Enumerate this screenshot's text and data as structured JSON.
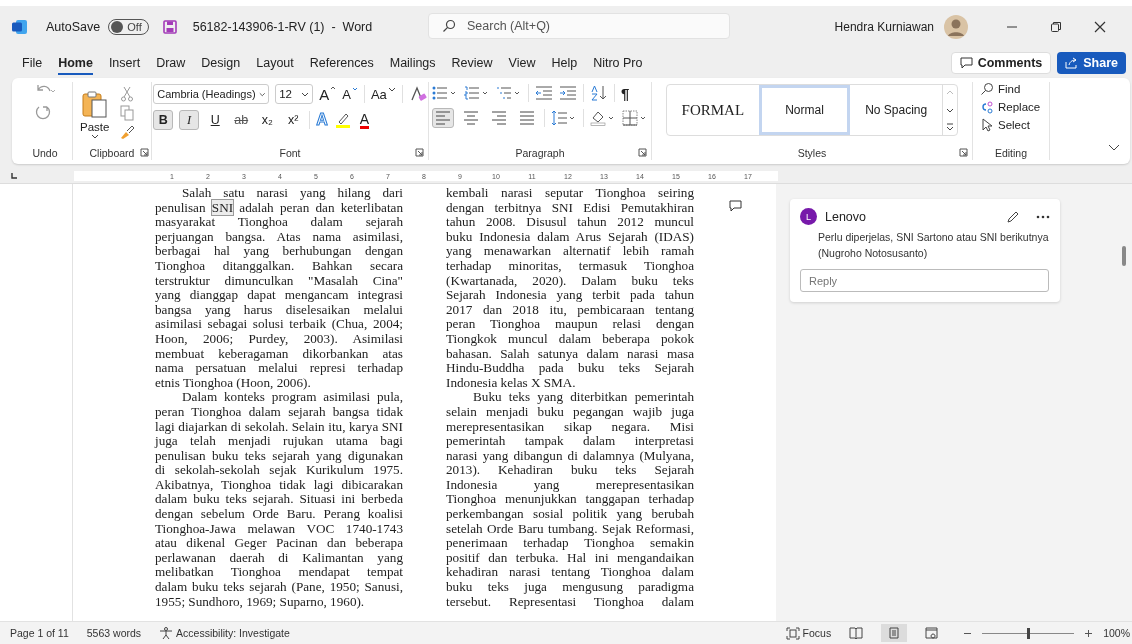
{
  "title_bar": {
    "autosave_label": "AutoSave",
    "autosave": {
      "on": false,
      "label": "Off"
    },
    "document_title": "56182-143906-1-RV (1)  -  Word",
    "search": {
      "placeholder": "Search (Alt+Q)"
    },
    "user_name": "Hendra Kurniawan"
  },
  "menu_tabs": [
    {
      "label": "File",
      "selected": false
    },
    {
      "label": "Home",
      "selected": true
    },
    {
      "label": "Insert",
      "selected": false
    },
    {
      "label": "Draw",
      "selected": false
    },
    {
      "label": "Design",
      "selected": false
    },
    {
      "label": "Layout",
      "selected": false
    },
    {
      "label": "References",
      "selected": false
    },
    {
      "label": "Mailings",
      "selected": false
    },
    {
      "label": "Review",
      "selected": false
    },
    {
      "label": "View",
      "selected": false
    },
    {
      "label": "Help",
      "selected": false
    },
    {
      "label": "Nitro Pro",
      "selected": false
    }
  ],
  "comments_button": "Comments",
  "share_button": "Share",
  "undo_group": {
    "label": "Undo"
  },
  "clipboard_group": {
    "label": "Clipboard",
    "paste": "Paste"
  },
  "font_group": {
    "label": "Font",
    "font_name": "Cambria (Headings)",
    "font_size": "12",
    "grow": "A",
    "shrink": "A",
    "change_case": "Aa",
    "format_buttons": [
      {
        "label": "B",
        "kind": "bold",
        "selected": true
      },
      {
        "label": "I",
        "kind": "italic",
        "selected": true
      },
      {
        "label": "U",
        "kind": "underline",
        "selected": false
      },
      {
        "label": "ab",
        "kind": "strike",
        "selected": false
      },
      {
        "label": "x₂",
        "kind": "subscript",
        "selected": false
      },
      {
        "label": "x²",
        "kind": "superscript",
        "selected": false
      }
    ],
    "text_effects": "A",
    "font_color": "A"
  },
  "paragraph_group": {
    "label": "Paragraph",
    "pilcrow": "¶",
    "alignments": [
      {
        "kind": "left",
        "selected": true
      },
      {
        "kind": "center",
        "selected": false
      },
      {
        "kind": "right",
        "selected": false
      },
      {
        "kind": "justify",
        "selected": false
      }
    ]
  },
  "styles_group": {
    "label": "Styles",
    "styles": [
      {
        "label": "FORMAL",
        "kind": "serif",
        "selected": false
      },
      {
        "label": "Normal",
        "kind": "sans",
        "selected": true
      },
      {
        "label": "No Spacing",
        "kind": "sans",
        "selected": false
      }
    ]
  },
  "editing_group": {
    "label": "Editing",
    "items": [
      {
        "label": "Find",
        "kind": "find"
      },
      {
        "label": "Replace",
        "kind": "replace"
      },
      {
        "label": "Select",
        "kind": "select"
      }
    ]
  },
  "ruler_marks": [
    "1",
    "2",
    "3",
    "4",
    "5",
    "6",
    "7",
    "8",
    "9",
    "10",
    "11",
    "12",
    "13",
    "14",
    "15",
    "16",
    "17"
  ],
  "columns": [
    {
      "paragraphs": [
        {
          "first_line_indent": true,
          "continues": false,
          "lines": [
            "Salah satu narasi yang hilang dari",
            {
              "before": "penulisan ",
              "anchor": "SNI",
              "after": " adalah peran dan keterlibatan"
            },
            "masyarakat Tionghoa dalam sejarah",
            "perjuangan bangsa. Atas nama asimilasi,",
            "berbagai hal yang berhubungan dengan",
            "Tionghoa ditanggalkan. Bahkan secara",
            "terstruktur dimunculkan \"Masalah Cina\"",
            "yang dianggap dapat mengancam integrasi",
            "bangsa yang harus diselesaikan melalui",
            "asimilasi sebagai solusi terbaik (Chua, 2004;",
            "Hoon, 2006; Purdey, 2003). Asimilasi",
            "membuat keberagaman dikorbankan atas",
            "nama persatuan melalui represi terhadap",
            "etnis Tionghoa (Hoon, 2006)."
          ]
        },
        {
          "first_line_indent": true,
          "continues": false,
          "lines": [
            "Dalam konteks program asimilasi pula,",
            "peran Tionghoa dalam sejarah bangsa tidak",
            "lagi diajarkan di sekolah. Selain itu, karya SNI",
            "juga telah menjadi rujukan utama bagi",
            "penulisan buku teks sejarah yang digunakan",
            "di sekolah-sekolah sejak Kurikulum 1975.",
            "Akibatnya, Tionghoa tidak lagi dibicarakan",
            "dalam buku teks sejarah. Situasi ini berbeda",
            "dengan sebelum Orde Baru. Perang koalisi",
            "Tionghoa-Jawa melawan VOC 1740-1743",
            "atau dikenal Geger Pacinan dan beberapa",
            "perlawanan daerah di Kalimantan yang",
            "melibatkan Tionghoa mendapat tempat",
            "dalam buku teks sejarah (Pane, 1950; Sanusi,",
            "1955; Sundhoro, 1969; Suparno, 1960)."
          ]
        }
      ]
    },
    {
      "paragraphs": [
        {
          "first_line_indent": false,
          "continues": false,
          "lines": [
            "kembali narasi seputar Tionghoa seiring",
            "dengan terbitnya SNI Edisi Pemutakhiran",
            "tahun 2008. Disusul tahun 2012 muncul",
            "buku Indonesia dalam Arus Sejarah (IDAS)",
            "yang menawarkan alternatif lebih ramah",
            "terhadap minoritas, termasuk Tionghoa",
            "(Kwartanada, 2020). Dalam buku teks",
            "Sejarah Indonesia yang terbit pada tahun",
            "2017 dan 2018 itu, pembicaraan tentang",
            "peran Tionghoa maupun relasi dengan",
            "Tiongkok muncul dalam beberapa pokok",
            "bahasan. Salah satunya dalam narasi masa",
            "Hindu-Buddha pada buku teks Sejarah",
            "Indonesia kelas X SMA."
          ]
        },
        {
          "first_line_indent": true,
          "continues": true,
          "lines": [
            "Buku teks yang diterbitkan pemerintah",
            "selain menjadi buku pegangan wajib juga",
            "merepresentasikan sikap negara. Misi",
            "pemerintah tampak dalam interpretasi",
            "narasi yang dibangun di dalamnya (Mulyana,",
            "2013). Kehadiran buku teks Sejarah",
            "Indonesia yang merepresentasikan",
            "Tionghoa menunjukkan tanggapan terhadap",
            "perkembangan sosial politik yang berubah",
            "setelah Orde Baru tumbang. Sejak Reformasi,",
            "penerimaan terhadap Tionghoa semakin",
            "positif dan terbuka. Hal ini mengandaikan",
            "kehadiran narasi tentang Tionghoa dalam",
            "buku teks juga mengusung paradigma",
            "tersebut. Representasi Tionghoa dalam"
          ]
        }
      ]
    }
  ],
  "comment": {
    "author": "Lenovo",
    "initial": "L",
    "color": "#7719aa",
    "text": "Perlu diperjelas, SNI Sartono atau SNI berikutnya (Nugroho Notosusanto)",
    "reply_placeholder": "Reply"
  },
  "status_bar": {
    "page": "Page 1 of 11",
    "words": "5563 words",
    "accessibility": "Accessibility: Investigate",
    "focus": "Focus",
    "views": [
      {
        "kind": "read",
        "selected": false
      },
      {
        "kind": "print",
        "selected": true
      },
      {
        "kind": "web",
        "selected": false
      }
    ],
    "zoom": {
      "level": 0.5,
      "label": "100%"
    }
  }
}
